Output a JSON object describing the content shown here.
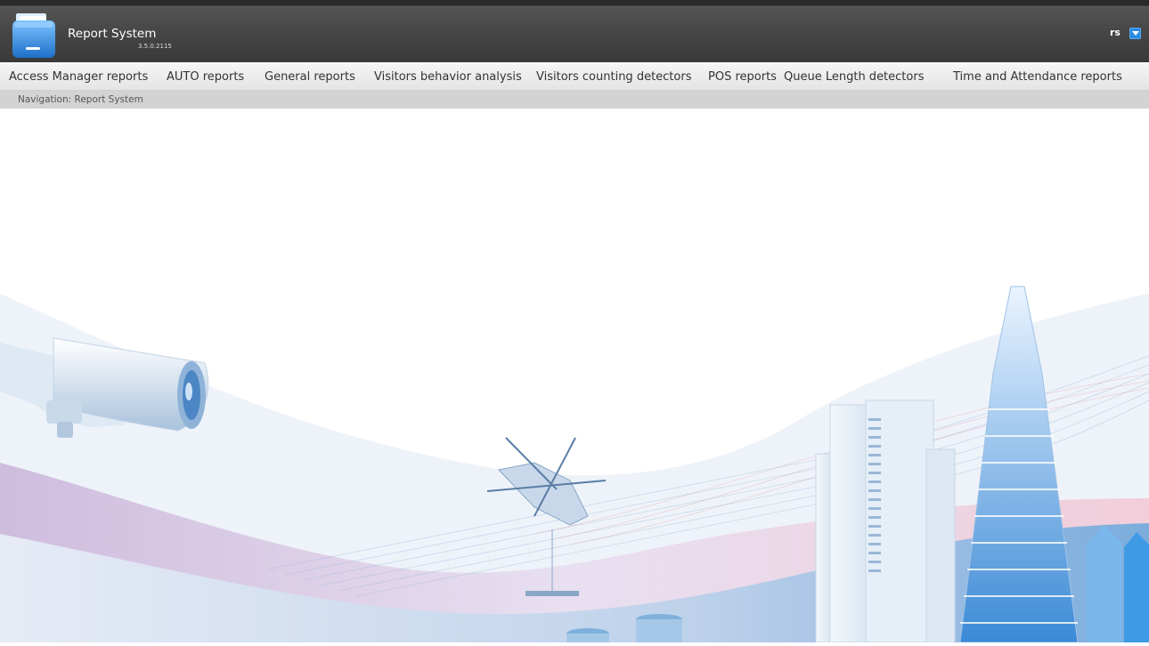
{
  "app": {
    "title": "Report System",
    "version": "3.5.0.2115",
    "icon": "folder-icon"
  },
  "user": {
    "name": "rs",
    "menu_icon": "chevron-down-icon"
  },
  "menu": {
    "items": [
      "Access Manager reports",
      "AUTO reports",
      "General reports",
      "Visitors behavior analysis",
      "Visitors counting detectors",
      "POS reports",
      "Queue Length detectors",
      "Time and Attendance reports"
    ]
  },
  "navigation": {
    "label": "Navigation: Report System"
  },
  "colors": {
    "header": "#444444",
    "menu_bg": "#eeeeee",
    "nav_bg": "#d3d3d3",
    "accent": "#2a8be2"
  }
}
